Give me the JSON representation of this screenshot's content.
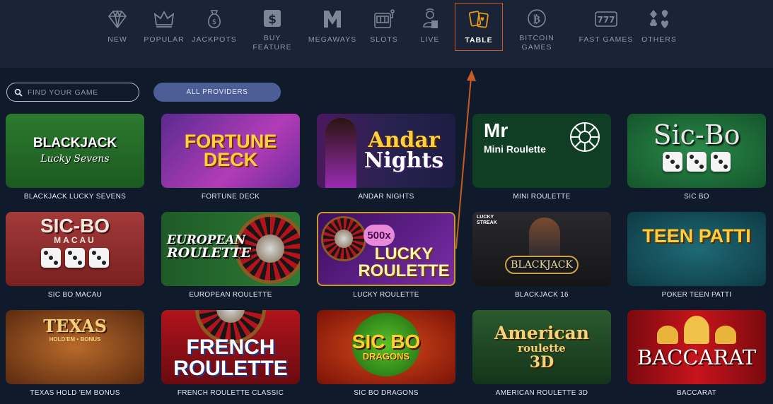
{
  "nav": {
    "categories": [
      {
        "label": "NEW",
        "icon": "diamond-icon"
      },
      {
        "label": "POPULAR",
        "icon": "crown-icon"
      },
      {
        "label": "JACKPOTS",
        "icon": "money-bag-icon"
      },
      {
        "label": "BUY FEATURE",
        "icon": "dollar-box-icon"
      },
      {
        "label": "MEGAWAYS",
        "icon": "megaways-m-icon"
      },
      {
        "label": "SLOTS",
        "icon": "slot-machine-icon"
      },
      {
        "label": "LIVE",
        "icon": "live-dealer-icon"
      },
      {
        "label": "TABLE",
        "icon": "playing-cards-icon",
        "active": true
      },
      {
        "label": "BITCOIN\nGAMES",
        "icon": "bitcoin-icon"
      },
      {
        "label": "FAST GAMES",
        "icon": "777-icon"
      },
      {
        "label": "OTHERS",
        "icon": "card-suits-icon"
      }
    ]
  },
  "filters": {
    "search_placeholder": "FIND YOUR GAME",
    "providers_label": "ALL PROVIDERS"
  },
  "games": [
    {
      "name": "BLACKJACK LUCKY SEVENS",
      "art": [
        "BLACKJACK",
        "Lucky Sevens"
      ]
    },
    {
      "name": "FORTUNE DECK",
      "art": [
        "FORTUNE",
        "DECK"
      ]
    },
    {
      "name": "ANDAR NIGHTS",
      "art": [
        "Andar",
        "Nights"
      ]
    },
    {
      "name": "MINI ROULETTE",
      "art": [
        "Mr",
        "Mini Roulette"
      ]
    },
    {
      "name": "SIC BO",
      "art": [
        "Sic-Bo"
      ]
    },
    {
      "name": "SIC BO MACAU",
      "art": [
        "SIC-BO",
        "MACAU"
      ]
    },
    {
      "name": "EUROPEAN ROULETTE",
      "art": [
        "EUROPEAN",
        "ROULETTE"
      ]
    },
    {
      "name": "LUCKY ROULETTE",
      "art": [
        "500x",
        "LUCKY",
        "ROULETTE"
      ]
    },
    {
      "name": "BLACKJACK 16",
      "art": [
        "LUCKY STREAK",
        "BLACKJACK"
      ]
    },
    {
      "name": "POKER TEEN PATTI",
      "art": [
        "TEEN PATTI"
      ]
    },
    {
      "name": "TEXAS HOLD 'EM BONUS",
      "art": [
        "TEXAS",
        "HOLD'EM • BONUS"
      ]
    },
    {
      "name": "FRENCH ROULETTE CLASSIC",
      "art": [
        "FRENCH",
        "ROULETTE"
      ]
    },
    {
      "name": "SIC BO DRAGONS",
      "art": [
        "SIC BO",
        "DRAGONS"
      ]
    },
    {
      "name": "AMERICAN ROULETTE 3D",
      "art": [
        "American",
        "roulette",
        "3D"
      ]
    },
    {
      "name": "BACCARAT",
      "art": [
        "BACCARAT"
      ]
    }
  ],
  "colors": {
    "page_bg": "#0f1a2b",
    "topbar_bg": "#1a2436",
    "active_outline": "#d0541f",
    "providers_bg": "#4d5e96"
  }
}
